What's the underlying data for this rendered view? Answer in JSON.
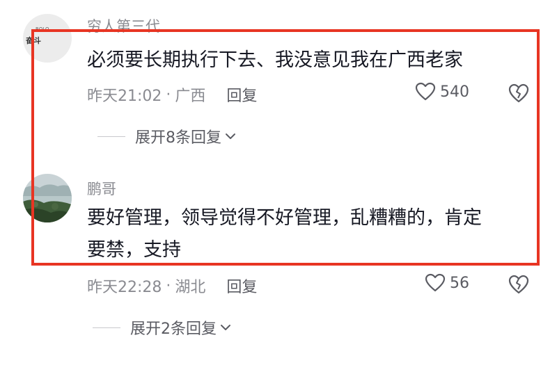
{
  "comments": [
    {
      "username": "穷人第三代",
      "avatar_text": "奋斗",
      "avatar_small_text": "ROLO",
      "content_lines": [
        "必须要长期执行下去、我没意见我在广西老家"
      ],
      "time": "昨天21:02",
      "location": "广西",
      "reply_label": "回复",
      "likes": "540",
      "expand_label": "展开8条回复"
    },
    {
      "username": "鹏哥",
      "content_lines": [
        "要好管理，领导觉得不好管理，乱糟糟的，肯定",
        "要禁，支持"
      ],
      "time": "昨天22:28",
      "location": "湖北",
      "reply_label": "回复",
      "likes": "56",
      "expand_label": "展开2条回复"
    }
  ],
  "separator": "·",
  "colors": {
    "highlight": "#e83523",
    "text_primary": "#161823",
    "text_secondary": "#8a8b91"
  }
}
